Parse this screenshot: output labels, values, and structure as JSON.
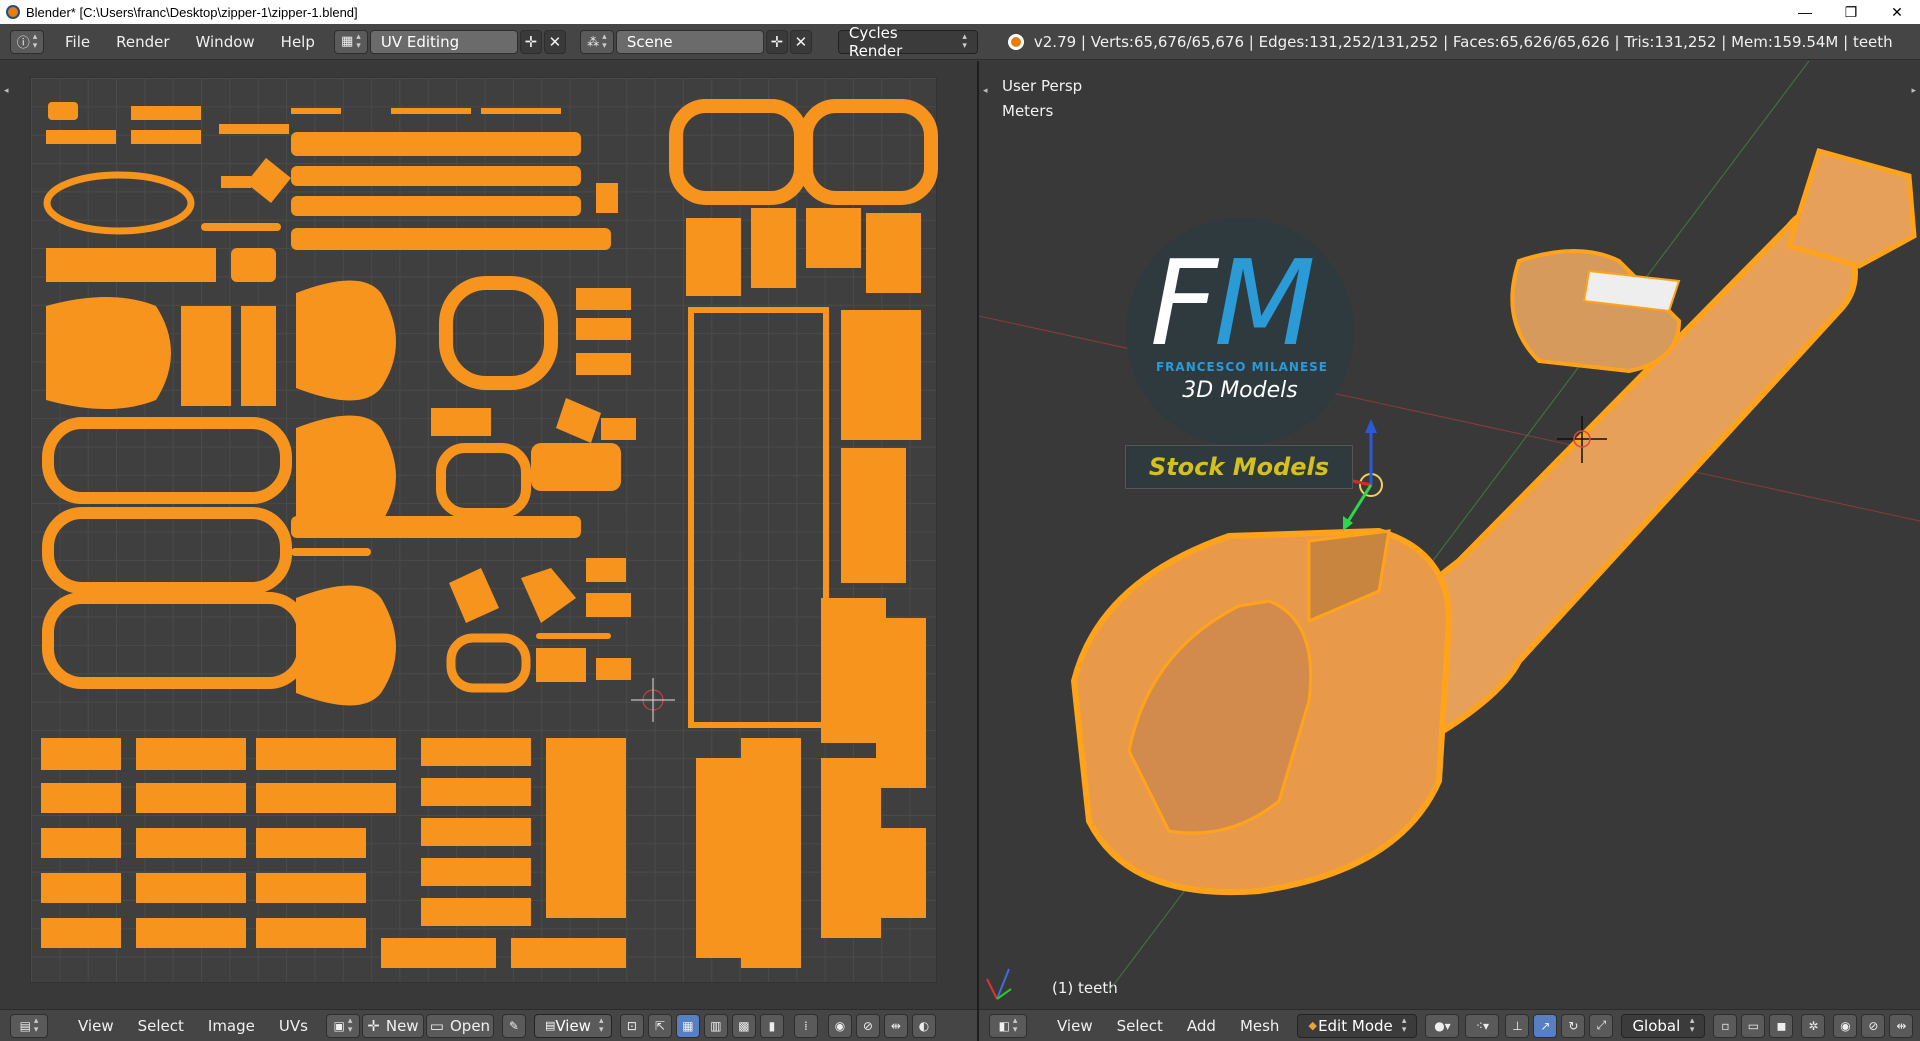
{
  "window": {
    "title": "Blender* [C:\\Users\\franc\\Desktop\\zipper-1\\zipper-1.blend]",
    "minimize": "—",
    "restore": "❐",
    "close": "✕"
  },
  "info_header": {
    "menus": [
      "File",
      "Render",
      "Window",
      "Help"
    ],
    "layout_name": "UV Editing",
    "scene_name": "Scene",
    "render_engine": "Cycles Render",
    "stats": "v2.79 | Verts:65,676/65,676 | Edges:131,252/131,252 | Faces:65,626/65,626 | Tris:131,252 | Mem:159.54M | teeth"
  },
  "view3d": {
    "view_label": "User Persp",
    "units_label": "Meters",
    "object_label": "(1) teeth"
  },
  "logo": {
    "f": "F",
    "m": "M",
    "subtitle": "FRANCESCO MILANESE",
    "models": "3D Models",
    "stock": "Stock Models"
  },
  "uv_header": {
    "menus": [
      "View",
      "Select",
      "Image",
      "UVs"
    ],
    "new_label": "New",
    "open_label": "Open",
    "view_label": "View"
  },
  "view3d_header": {
    "menus": [
      "View",
      "Select",
      "Add",
      "Mesh"
    ],
    "mode": "Edit Mode",
    "orientation": "Global"
  },
  "colors": {
    "uv_orange": "#f7941d",
    "mesh_orange": "#ffa31a",
    "logo_blue": "#2a9bd6",
    "stock_yellow": "#d4c21c"
  }
}
